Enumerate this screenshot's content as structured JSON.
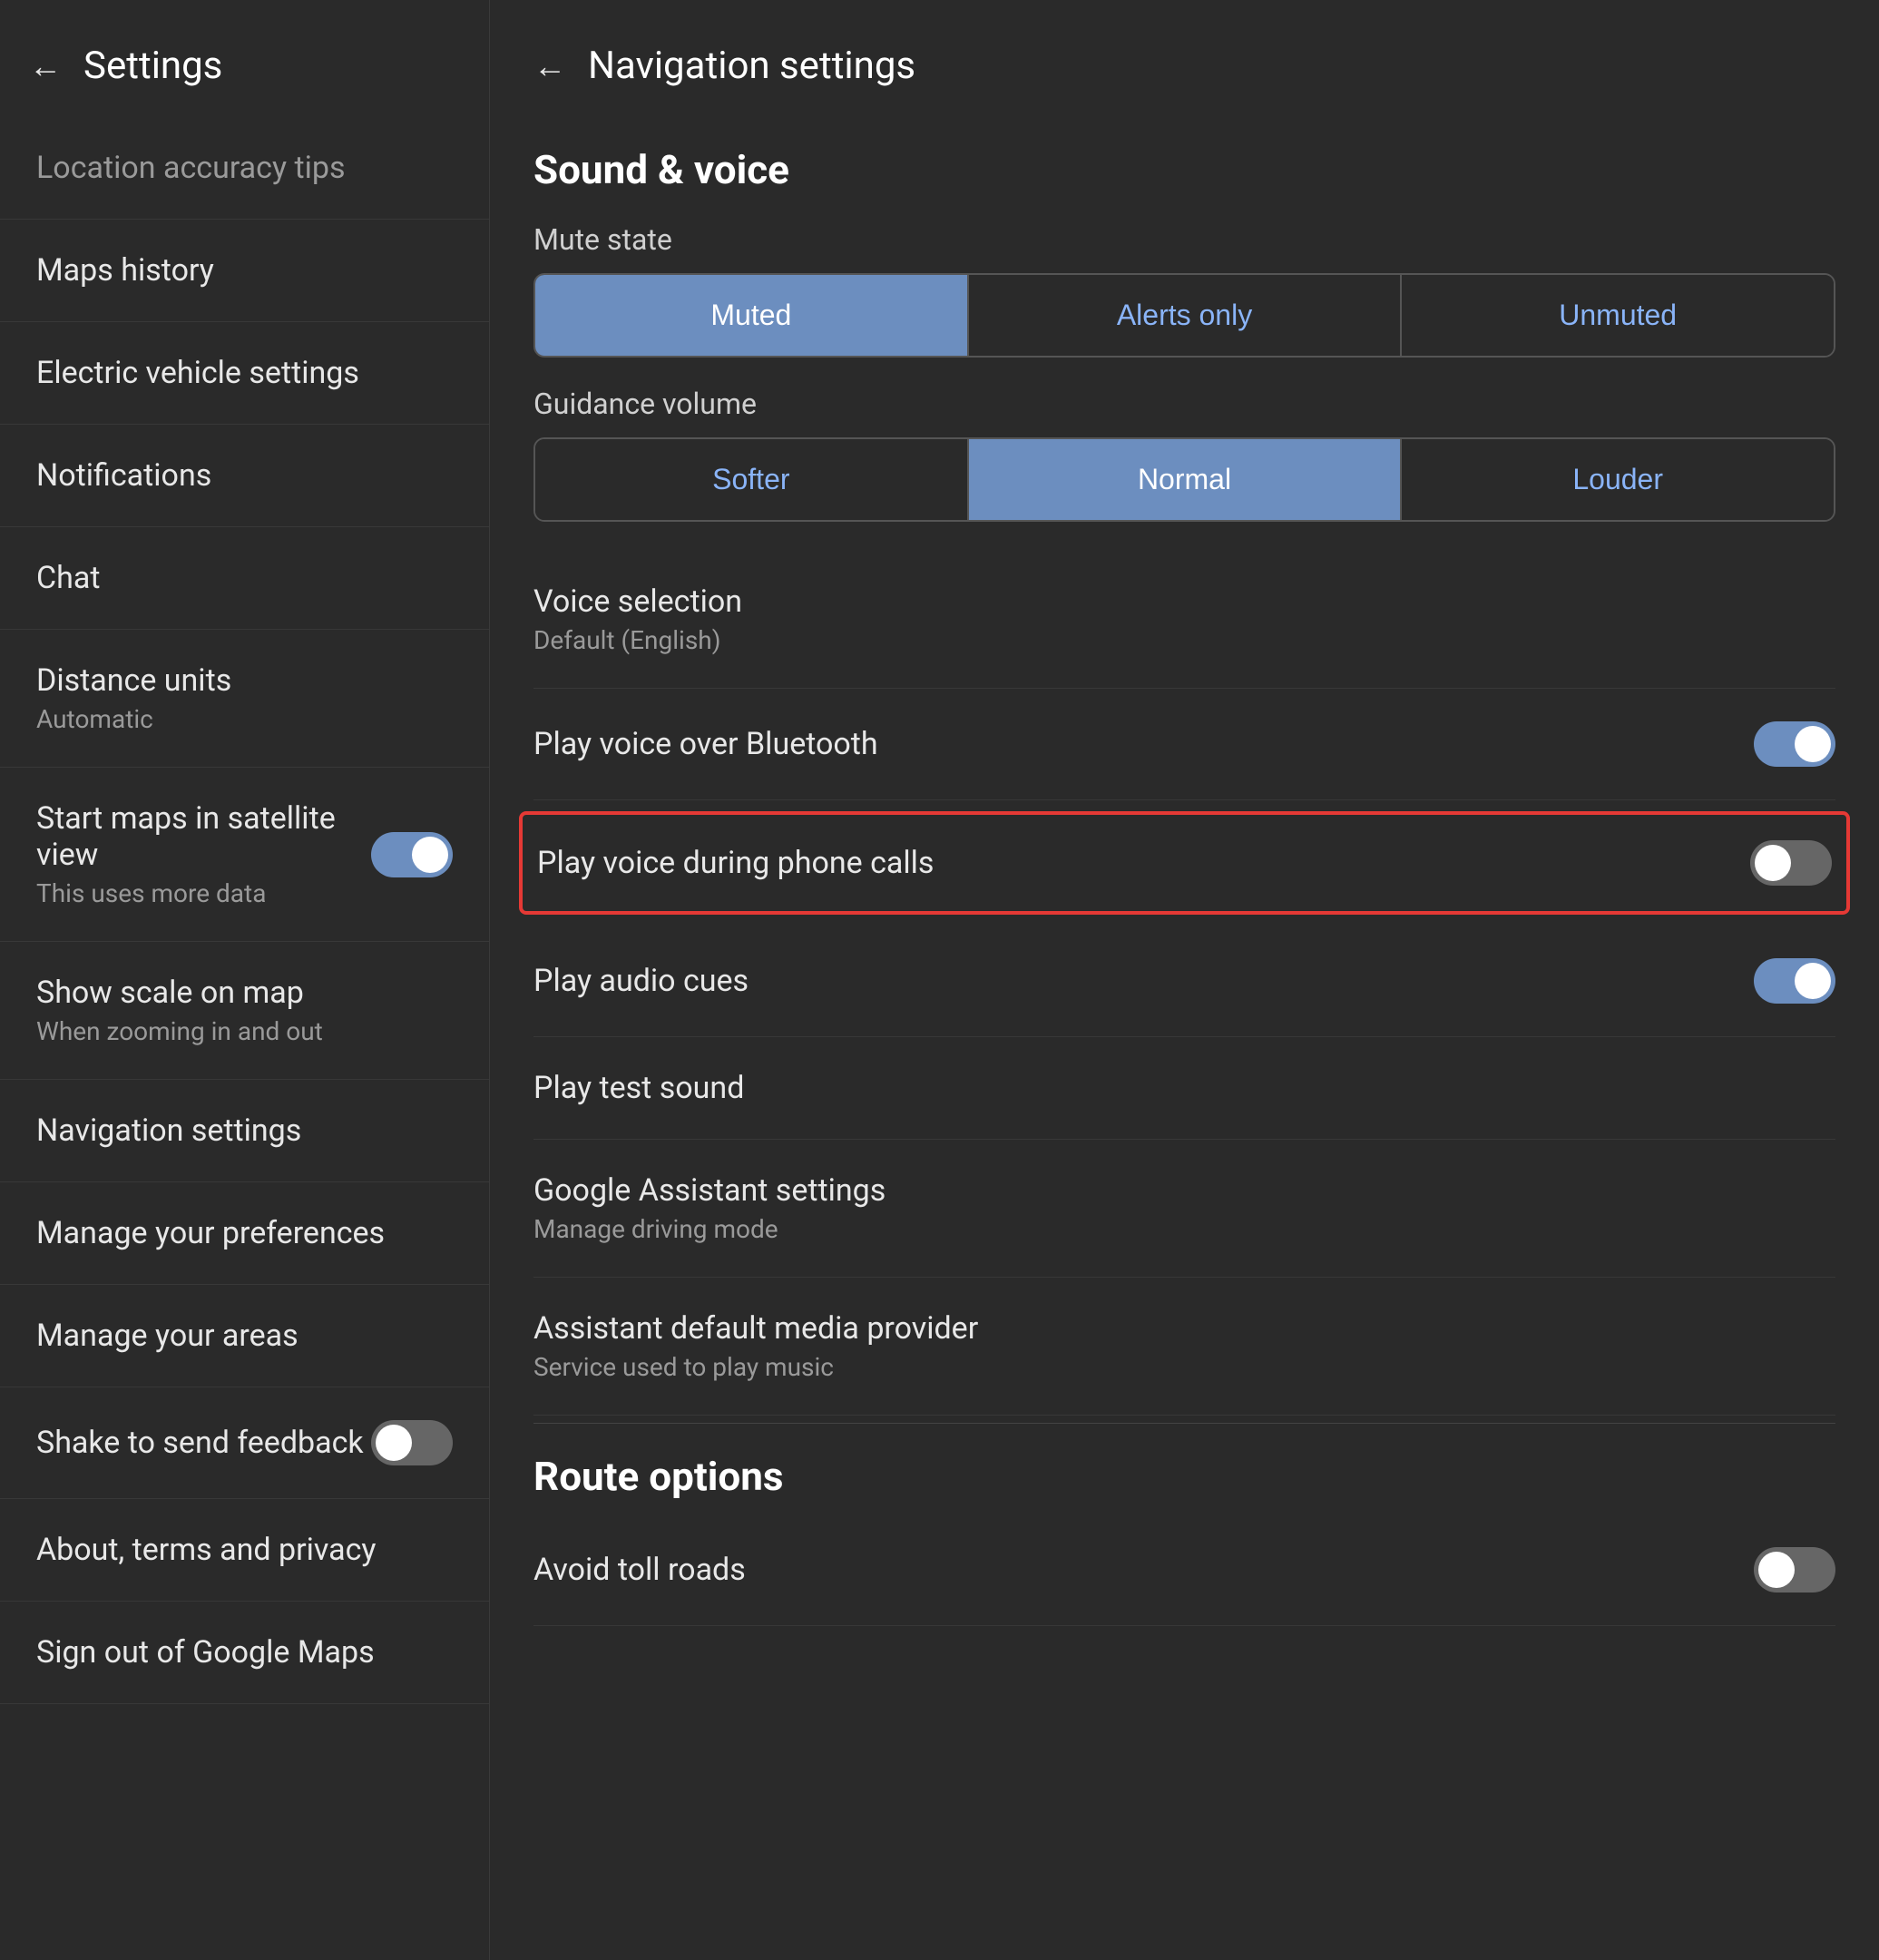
{
  "left": {
    "header": {
      "back_label": "←",
      "title": "Settings"
    },
    "items": [
      {
        "id": "location-accuracy",
        "title": "Location accuracy tips",
        "subtitle": "",
        "toggle": null,
        "faded": true
      },
      {
        "id": "maps-history",
        "title": "Maps history",
        "subtitle": "",
        "toggle": null
      },
      {
        "id": "electric-vehicle",
        "title": "Electric vehicle settings",
        "subtitle": "",
        "toggle": null
      },
      {
        "id": "notifications",
        "title": "Notifications",
        "subtitle": "",
        "toggle": null
      },
      {
        "id": "chat",
        "title": "Chat",
        "subtitle": "",
        "toggle": null
      },
      {
        "id": "distance-units",
        "title": "Distance units",
        "subtitle": "Automatic",
        "toggle": null
      },
      {
        "id": "satellite-view",
        "title": "Start maps in satellite view",
        "subtitle": "This uses more data",
        "toggle": "on"
      },
      {
        "id": "show-scale",
        "title": "Show scale on map",
        "subtitle": "When zooming in and out",
        "toggle": null
      },
      {
        "id": "navigation-settings",
        "title": "Navigation settings",
        "subtitle": "",
        "toggle": null
      },
      {
        "id": "manage-preferences",
        "title": "Manage your preferences",
        "subtitle": "",
        "toggle": null
      },
      {
        "id": "manage-areas",
        "title": "Manage your areas",
        "subtitle": "",
        "toggle": null
      },
      {
        "id": "shake-feedback",
        "title": "Shake to send feedback",
        "subtitle": "",
        "toggle": "off"
      },
      {
        "id": "about-terms",
        "title": "About, terms and privacy",
        "subtitle": "",
        "toggle": null
      },
      {
        "id": "sign-out",
        "title": "Sign out of Google Maps",
        "subtitle": "",
        "toggle": null
      }
    ]
  },
  "right": {
    "header": {
      "back_label": "←",
      "title": "Navigation settings"
    },
    "sound_voice": {
      "section_title": "Sound & voice",
      "mute_state_label": "Mute state",
      "mute_options": [
        "Muted",
        "Alerts only",
        "Unmuted"
      ],
      "mute_active": 0,
      "guidance_volume_label": "Guidance volume",
      "volume_options": [
        "Softer",
        "Normal",
        "Louder"
      ],
      "volume_active": 1,
      "voice_selection_title": "Voice selection",
      "voice_selection_subtitle": "Default (English)",
      "play_bluetooth_title": "Play voice over Bluetooth",
      "play_bluetooth_toggle": "on",
      "play_phone_calls_title": "Play voice during phone calls",
      "play_phone_calls_toggle": "off",
      "play_audio_cues_title": "Play audio cues",
      "play_audio_cues_toggle": "on",
      "play_test_sound_title": "Play test sound",
      "google_assistant_title": "Google Assistant settings",
      "google_assistant_subtitle": "Manage driving mode",
      "assistant_media_title": "Assistant default media provider",
      "assistant_media_subtitle": "Service used to play music"
    },
    "route_options": {
      "section_title": "Route options",
      "avoid_toll_title": "Avoid toll roads",
      "avoid_toll_toggle": "off"
    }
  }
}
